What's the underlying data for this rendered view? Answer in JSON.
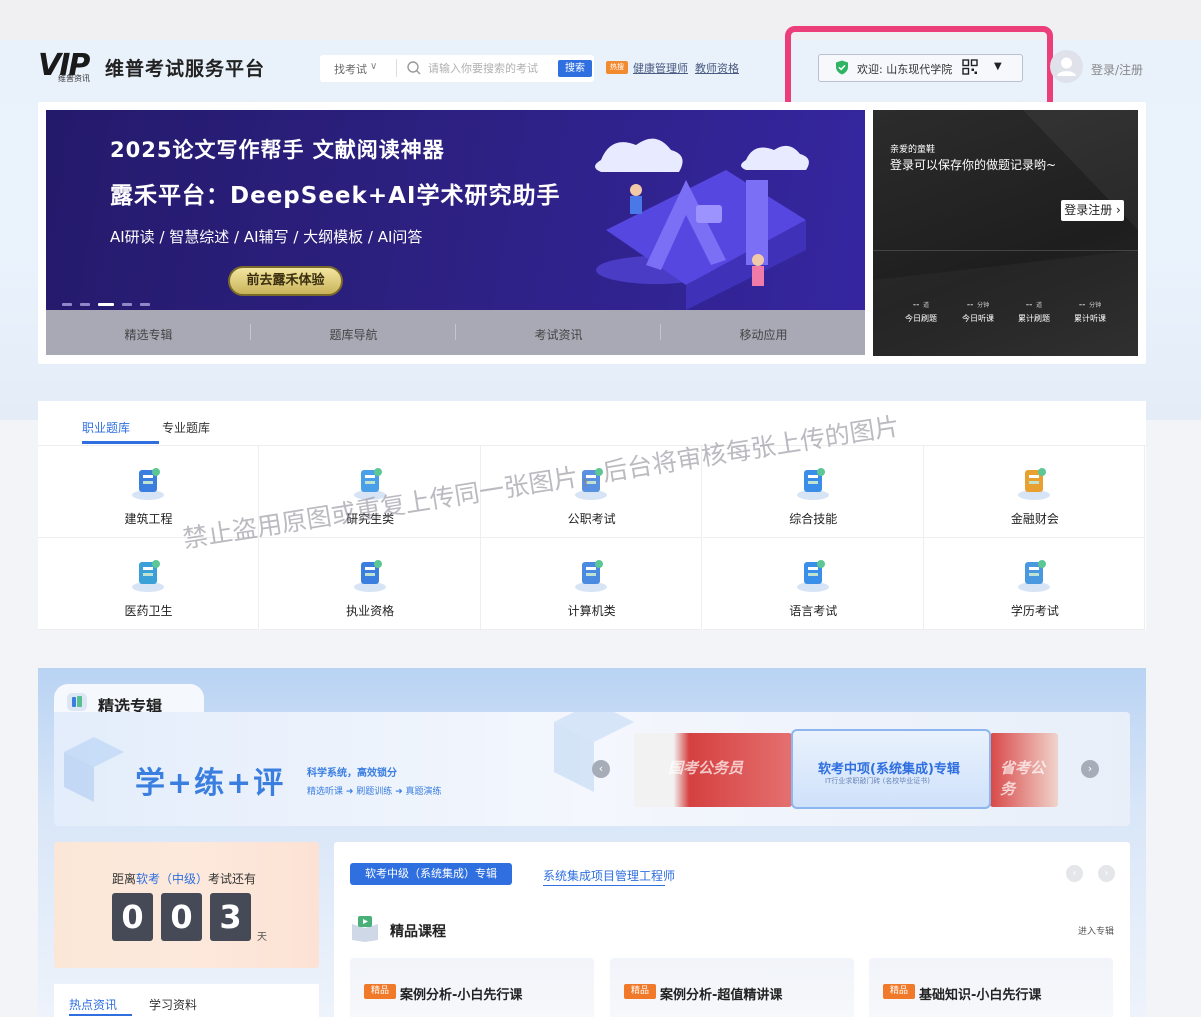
{
  "header": {
    "logo_text": "VIP",
    "logo_sub": "维普资讯",
    "site_name": "维普考试服务平台",
    "search": {
      "category": "找考试",
      "placeholder": "请输入你要搜索的考试",
      "button": "搜索"
    },
    "hot_badge": "热搜",
    "hot_links": [
      "健康管理师",
      "教师资格"
    ],
    "welcome": "欢迎: 山东现代学院",
    "login": "登录/注册"
  },
  "banner": {
    "line1": "2025论文写作帮手 文献阅读神器",
    "line2": "露禾平台：DeepSeek+AI学术研究助手",
    "line3": "AI研读 / 智慧综述 / AI辅写 / 大纲模板 / AI问答",
    "cta": "前去露禾体验",
    "nav": [
      "精选专辑",
      "题库导航",
      "考试资讯",
      "移动应用"
    ]
  },
  "user_panel": {
    "greeting": "亲爱的童鞋",
    "message": "登录可以保存你的做题记录哟~",
    "button": "登录注册 ›",
    "stats": [
      {
        "value": "--",
        "unit": "道",
        "label": "今日刷题"
      },
      {
        "value": "--",
        "unit": "分钟",
        "label": "今日听课"
      },
      {
        "value": "--",
        "unit": "道",
        "label": "累计刷题"
      },
      {
        "value": "--",
        "unit": "分钟",
        "label": "累计听课"
      }
    ]
  },
  "categories": {
    "tabs": [
      "职业题库",
      "专业题库"
    ],
    "items": [
      "建筑工程",
      "研究生类",
      "公职考试",
      "综合技能",
      "金融财会",
      "医药卫生",
      "执业资格",
      "计算机类",
      "语言考试",
      "学历考试"
    ]
  },
  "watermark": "禁止盗用原图或重复上传同一张图片，后台将审核每张上传的图片",
  "featured": {
    "title": "精选专辑",
    "promo_big": "学+练+评",
    "promo_sub": "科学系统，高效锁分",
    "promo_steps": "精选听课 ➜ 刷题训练 ➜ 真题演练",
    "cards": [
      "国考公务员",
      "软考中项(系统集成)专辑",
      "省考公务"
    ],
    "card_sub": "IT行业求职敲门砖 (名校毕业证书)"
  },
  "countdown": {
    "prefix": "距离",
    "exam": "软考（中级）",
    "suffix": "考试还有",
    "digits": [
      "0",
      "0",
      "3"
    ],
    "unit": "天"
  },
  "news_tabs": [
    "热点资讯",
    "学习资料"
  ],
  "album": {
    "tabs": [
      "软考中级（系统集成）专辑",
      "系统集成项目管理工程师"
    ],
    "section_title": "精品课程",
    "more": "进入专辑",
    "tag": "精品",
    "courses": [
      "案例分析-小白先行课",
      "案例分析-超值精讲课",
      "基础知识-小白先行课"
    ]
  },
  "colors": {
    "accent": "#2f6fe0",
    "highlight": "#ec3f7a",
    "tag": "#f07a2a"
  }
}
